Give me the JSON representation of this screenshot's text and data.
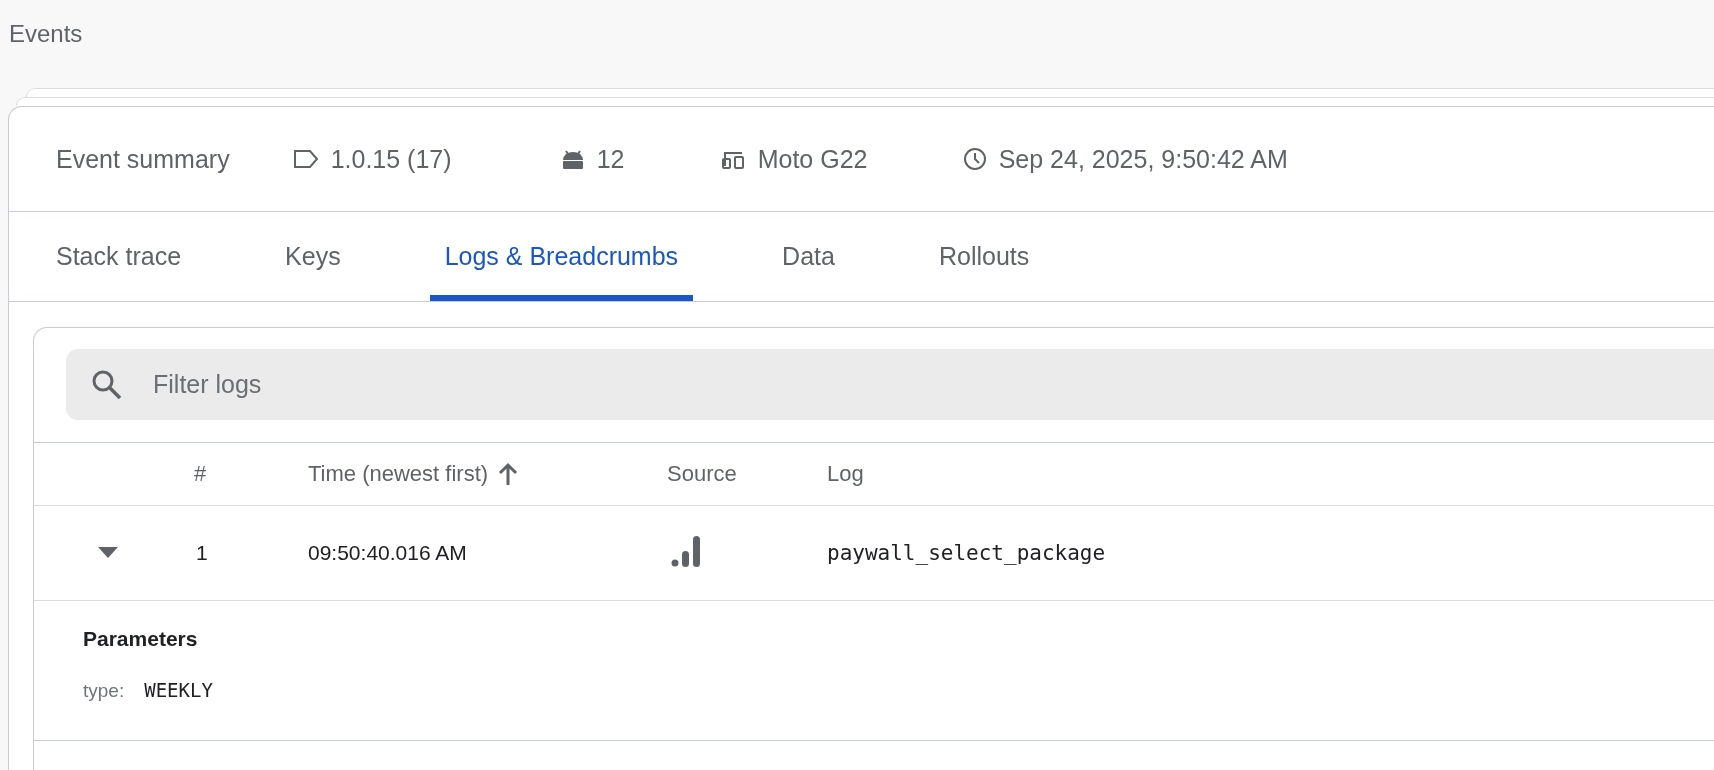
{
  "page_title": "Events",
  "summary": {
    "title": "Event summary",
    "items": [
      {
        "kind": "version",
        "text": "1.0.15 (17)"
      },
      {
        "kind": "os",
        "text": "12"
      },
      {
        "kind": "device",
        "text": "Moto G22"
      },
      {
        "kind": "time",
        "text": "Sep 24, 2025, 9:50:42 AM"
      }
    ]
  },
  "tabs": [
    {
      "label": "Stack trace",
      "selected": false
    },
    {
      "label": "Keys",
      "selected": false
    },
    {
      "label": "Logs & Breadcrumbs",
      "selected": true
    },
    {
      "label": "Data",
      "selected": false
    },
    {
      "label": "Rollouts",
      "selected": false
    }
  ],
  "filter": {
    "placeholder": "Filter logs"
  },
  "table": {
    "columns": [
      "#",
      "Time (newest first)",
      "Source",
      "Log"
    ],
    "rows": [
      {
        "number": "1",
        "time": "09:50:40.016 AM",
        "log": "paywall_select_package",
        "expanded": true,
        "parameters": {
          "title": "Parameters",
          "items": [
            {
              "key": "type:",
              "value": "WEEKLY"
            }
          ]
        }
      }
    ]
  }
}
